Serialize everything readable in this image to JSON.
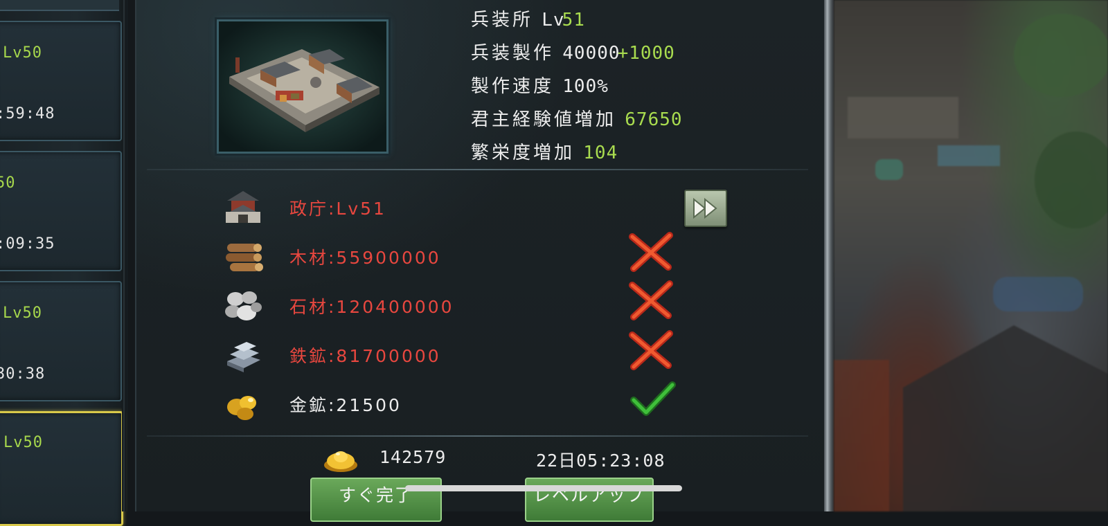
{
  "queue": [
    {
      "level": "Lv50",
      "time": ":59:48"
    },
    {
      "level": "50",
      "time": ":09:35"
    },
    {
      "level": "Lv50",
      "time": "30:38"
    },
    {
      "level": "Lv50",
      "time": ""
    }
  ],
  "building": {
    "name": "兵装所",
    "level": "Lv",
    "level_num": "51",
    "production_label": "兵装製作",
    "production_value": "40000",
    "production_bonus": "+1000",
    "speed_label": "製作速度",
    "speed_value": "100%",
    "exp_label": "君主経験値増加",
    "exp_value": "67650",
    "prosperity_label": "繁栄度増加",
    "prosperity_value": "104"
  },
  "requirements": [
    {
      "icon": "government-hall-icon",
      "label": "政庁:Lv51",
      "status": "none",
      "met": false
    },
    {
      "icon": "lumber-icon",
      "label": "木材:55900000",
      "status": "cross",
      "met": false
    },
    {
      "icon": "stone-icon",
      "label": "石材:120400000",
      "status": "cross",
      "met": false
    },
    {
      "icon": "iron-ore-icon",
      "label": "鉄鉱:81700000",
      "status": "cross",
      "met": false
    },
    {
      "icon": "gold-ore-icon",
      "label": "金鉱:21500",
      "status": "check",
      "met": true
    }
  ],
  "footer": {
    "gold_amount": "142579",
    "duration": "22日05:23:08",
    "instant_button": "すぐ完了",
    "levelup_button": "レベルアップ"
  },
  "colors": {
    "accent_green": "#a9dc4f",
    "unmet_red": "#e8473f",
    "selected_border": "#d9c94a"
  }
}
